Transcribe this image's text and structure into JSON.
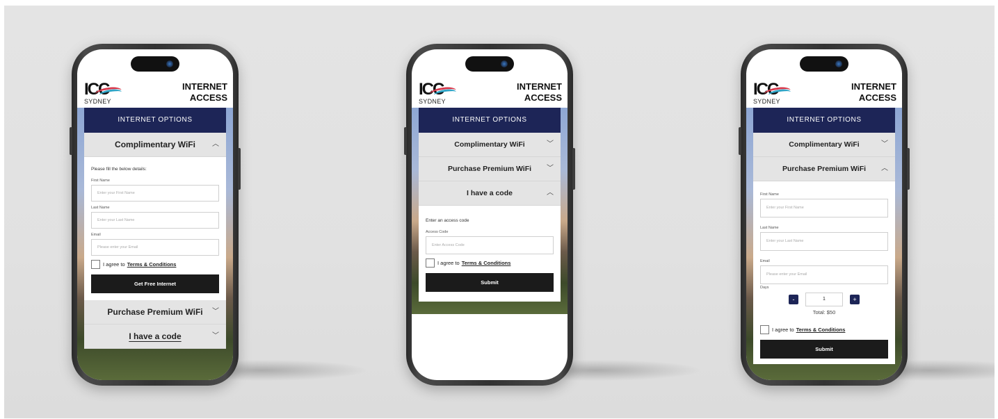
{
  "common": {
    "logo_city": "SYDNEY",
    "title_line1": "INTERNET",
    "title_line2": "ACCESS",
    "options_header": "INTERNET OPTIONS",
    "acc_complimentary": "Complimentary WiFi",
    "acc_premium": "Purchase Premium WiFi",
    "acc_code": "I have a code",
    "agree_prefix": "I agree to",
    "terms_link": "Terms & Conditions",
    "chev_up": "︿",
    "chev_down": "﹀"
  },
  "phone1": {
    "intro": "Please fill the below details:",
    "first_label": "First Name",
    "first_placeholder": "Enter your First Name",
    "last_label": "Last Name",
    "last_placeholder": "Enter your Last Name",
    "email_label": "Email",
    "email_placeholder": "Please enter your Email",
    "submit": "Get Free Internet"
  },
  "phone2": {
    "intro": "Enter an access code",
    "code_label": "Access Code",
    "code_placeholder": "Enter Access Code",
    "submit": "Submit"
  },
  "phone3": {
    "first_label": "First Name",
    "first_placeholder": "Enter your First Name",
    "last_label": "Last Name",
    "last_placeholder": "Enter your Last Name",
    "email_label": "Email",
    "email_placeholder": "Please enter your Email",
    "days_label": "Days",
    "minus": "-",
    "plus": "+",
    "quantity": "1",
    "total": "Total: $50",
    "submit": "Submit"
  },
  "colors": {
    "navy": "#1d2557",
    "button_dark": "#1b1b1b",
    "accordion_bg": "#e4e4e4"
  }
}
